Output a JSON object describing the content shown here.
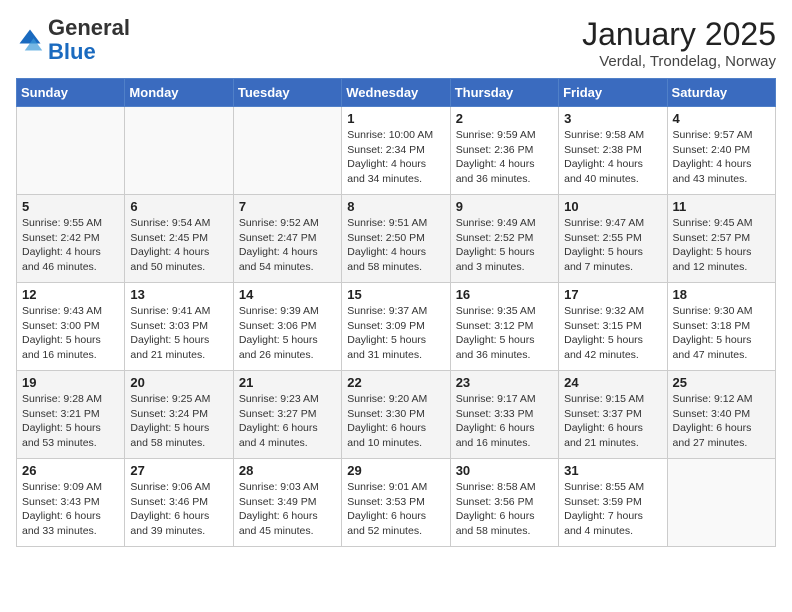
{
  "header": {
    "logo_general": "General",
    "logo_blue": "Blue",
    "title": "January 2025",
    "subtitle": "Verdal, Trondelag, Norway"
  },
  "weekdays": [
    "Sunday",
    "Monday",
    "Tuesday",
    "Wednesday",
    "Thursday",
    "Friday",
    "Saturday"
  ],
  "weeks": [
    [
      {
        "day": "",
        "info": ""
      },
      {
        "day": "",
        "info": ""
      },
      {
        "day": "",
        "info": ""
      },
      {
        "day": "1",
        "info": "Sunrise: 10:00 AM\nSunset: 2:34 PM\nDaylight: 4 hours\nand 34 minutes."
      },
      {
        "day": "2",
        "info": "Sunrise: 9:59 AM\nSunset: 2:36 PM\nDaylight: 4 hours\nand 36 minutes."
      },
      {
        "day": "3",
        "info": "Sunrise: 9:58 AM\nSunset: 2:38 PM\nDaylight: 4 hours\nand 40 minutes."
      },
      {
        "day": "4",
        "info": "Sunrise: 9:57 AM\nSunset: 2:40 PM\nDaylight: 4 hours\nand 43 minutes."
      }
    ],
    [
      {
        "day": "5",
        "info": "Sunrise: 9:55 AM\nSunset: 2:42 PM\nDaylight: 4 hours\nand 46 minutes."
      },
      {
        "day": "6",
        "info": "Sunrise: 9:54 AM\nSunset: 2:45 PM\nDaylight: 4 hours\nand 50 minutes."
      },
      {
        "day": "7",
        "info": "Sunrise: 9:52 AM\nSunset: 2:47 PM\nDaylight: 4 hours\nand 54 minutes."
      },
      {
        "day": "8",
        "info": "Sunrise: 9:51 AM\nSunset: 2:50 PM\nDaylight: 4 hours\nand 58 minutes."
      },
      {
        "day": "9",
        "info": "Sunrise: 9:49 AM\nSunset: 2:52 PM\nDaylight: 5 hours\nand 3 minutes."
      },
      {
        "day": "10",
        "info": "Sunrise: 9:47 AM\nSunset: 2:55 PM\nDaylight: 5 hours\nand 7 minutes."
      },
      {
        "day": "11",
        "info": "Sunrise: 9:45 AM\nSunset: 2:57 PM\nDaylight: 5 hours\nand 12 minutes."
      }
    ],
    [
      {
        "day": "12",
        "info": "Sunrise: 9:43 AM\nSunset: 3:00 PM\nDaylight: 5 hours\nand 16 minutes."
      },
      {
        "day": "13",
        "info": "Sunrise: 9:41 AM\nSunset: 3:03 PM\nDaylight: 5 hours\nand 21 minutes."
      },
      {
        "day": "14",
        "info": "Sunrise: 9:39 AM\nSunset: 3:06 PM\nDaylight: 5 hours\nand 26 minutes."
      },
      {
        "day": "15",
        "info": "Sunrise: 9:37 AM\nSunset: 3:09 PM\nDaylight: 5 hours\nand 31 minutes."
      },
      {
        "day": "16",
        "info": "Sunrise: 9:35 AM\nSunset: 3:12 PM\nDaylight: 5 hours\nand 36 minutes."
      },
      {
        "day": "17",
        "info": "Sunrise: 9:32 AM\nSunset: 3:15 PM\nDaylight: 5 hours\nand 42 minutes."
      },
      {
        "day": "18",
        "info": "Sunrise: 9:30 AM\nSunset: 3:18 PM\nDaylight: 5 hours\nand 47 minutes."
      }
    ],
    [
      {
        "day": "19",
        "info": "Sunrise: 9:28 AM\nSunset: 3:21 PM\nDaylight: 5 hours\nand 53 minutes."
      },
      {
        "day": "20",
        "info": "Sunrise: 9:25 AM\nSunset: 3:24 PM\nDaylight: 5 hours\nand 58 minutes."
      },
      {
        "day": "21",
        "info": "Sunrise: 9:23 AM\nSunset: 3:27 PM\nDaylight: 6 hours\nand 4 minutes."
      },
      {
        "day": "22",
        "info": "Sunrise: 9:20 AM\nSunset: 3:30 PM\nDaylight: 6 hours\nand 10 minutes."
      },
      {
        "day": "23",
        "info": "Sunrise: 9:17 AM\nSunset: 3:33 PM\nDaylight: 6 hours\nand 16 minutes."
      },
      {
        "day": "24",
        "info": "Sunrise: 9:15 AM\nSunset: 3:37 PM\nDaylight: 6 hours\nand 21 minutes."
      },
      {
        "day": "25",
        "info": "Sunrise: 9:12 AM\nSunset: 3:40 PM\nDaylight: 6 hours\nand 27 minutes."
      }
    ],
    [
      {
        "day": "26",
        "info": "Sunrise: 9:09 AM\nSunset: 3:43 PM\nDaylight: 6 hours\nand 33 minutes."
      },
      {
        "day": "27",
        "info": "Sunrise: 9:06 AM\nSunset: 3:46 PM\nDaylight: 6 hours\nand 39 minutes."
      },
      {
        "day": "28",
        "info": "Sunrise: 9:03 AM\nSunset: 3:49 PM\nDaylight: 6 hours\nand 45 minutes."
      },
      {
        "day": "29",
        "info": "Sunrise: 9:01 AM\nSunset: 3:53 PM\nDaylight: 6 hours\nand 52 minutes."
      },
      {
        "day": "30",
        "info": "Sunrise: 8:58 AM\nSunset: 3:56 PM\nDaylight: 6 hours\nand 58 minutes."
      },
      {
        "day": "31",
        "info": "Sunrise: 8:55 AM\nSunset: 3:59 PM\nDaylight: 7 hours\nand 4 minutes."
      },
      {
        "day": "",
        "info": ""
      }
    ]
  ]
}
